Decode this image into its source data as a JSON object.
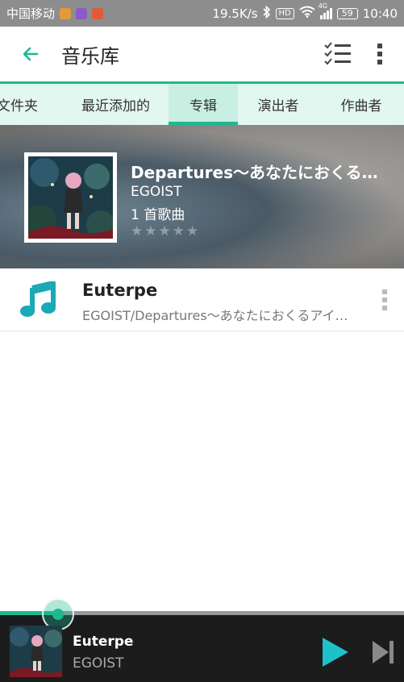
{
  "status_bar": {
    "carrier": "中国移动",
    "network_speed": "19.5K/s",
    "hd_label": "HD",
    "signal_label": "4G",
    "battery": "59",
    "time": "10:40"
  },
  "appbar": {
    "title": "音乐库",
    "icons": [
      "back-arrow-icon",
      "multi-select-icon",
      "more-vert-icon"
    ]
  },
  "tabs": [
    {
      "label": "文件夹",
      "active": false
    },
    {
      "label": "最近添加的",
      "active": false
    },
    {
      "label": "专辑",
      "active": true
    },
    {
      "label": "演出者",
      "active": false
    },
    {
      "label": "作曲者",
      "active": false
    }
  ],
  "album": {
    "title": "Departures～あなたにおくるアイの歌～",
    "artist": "EGOIST",
    "song_count": "1 首歌曲",
    "rating_stars": 0
  },
  "songs": [
    {
      "title": "Euterpe",
      "subtitle": "EGOIST/Departures～あなたにおくるアイの歌～"
    }
  ],
  "player": {
    "title": "Euterpe",
    "artist": "EGOIST",
    "progress_fraction": 0.14
  },
  "colors": {
    "accent": "#1db98f",
    "tabs_background": "#e3f7f1",
    "status_bar": "#8d8d8d",
    "player_background": "#1c1c1c"
  }
}
